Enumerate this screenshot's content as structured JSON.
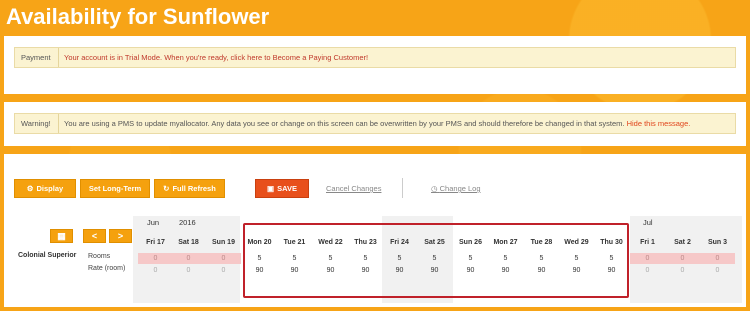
{
  "page": {
    "title": "Availability for Sunflower"
  },
  "payment_notice": {
    "label": "Payment",
    "message": "Your account is in Trial Mode. When you're ready, click here to Become a Paying Customer!"
  },
  "warning_notice": {
    "label": "Warning!",
    "message": "You are using a PMS to update myallocator. Any data you see or change on this screen can be overwritten by your PMS and should therefore be changed in that system.",
    "hide_link": "Hide this message."
  },
  "toolbar": {
    "display_label": "Display",
    "long_term_label": "Set Long-Term",
    "refresh_label": "Full Refresh",
    "save_label": "SAVE",
    "cancel_label": "Cancel Changes",
    "changelog_label": "Change Log"
  },
  "calendar": {
    "month_jun": "Jun",
    "year": "2016",
    "month_jul": "Jul",
    "prev_label": "<",
    "next_label": ">",
    "room_name": "Colonial Superior",
    "rooms_label": "Rooms",
    "rate_label": "Rate (room)",
    "days": [
      {
        "label": "Fri 17",
        "rooms": "0",
        "rate": "0"
      },
      {
        "label": "Sat 18",
        "rooms": "0",
        "rate": "0"
      },
      {
        "label": "Sun 19",
        "rooms": "0",
        "rate": "0"
      },
      {
        "label": "Mon 20",
        "rooms": "5",
        "rate": "90"
      },
      {
        "label": "Tue 21",
        "rooms": "5",
        "rate": "90"
      },
      {
        "label": "Wed 22",
        "rooms": "5",
        "rate": "90"
      },
      {
        "label": "Thu 23",
        "rooms": "5",
        "rate": "90"
      },
      {
        "label": "Fri 24",
        "rooms": "5",
        "rate": "90"
      },
      {
        "label": "Sat 25",
        "rooms": "5",
        "rate": "90"
      },
      {
        "label": "Sun 26",
        "rooms": "5",
        "rate": "90"
      },
      {
        "label": "Mon 27",
        "rooms": "5",
        "rate": "90"
      },
      {
        "label": "Tue 28",
        "rooms": "5",
        "rate": "90"
      },
      {
        "label": "Wed 29",
        "rooms": "5",
        "rate": "90"
      },
      {
        "label": "Thu 30",
        "rooms": "5",
        "rate": "90"
      },
      {
        "label": "Fri 1",
        "rooms": "0",
        "rate": "0"
      },
      {
        "label": "Sat 2",
        "rooms": "0",
        "rate": "0"
      },
      {
        "label": "Sun 3",
        "rooms": "0",
        "rate": "0"
      }
    ]
  },
  "colors": {
    "accent": "#f5a10e",
    "save": "#e8501c",
    "highlight": "#c0212a"
  }
}
